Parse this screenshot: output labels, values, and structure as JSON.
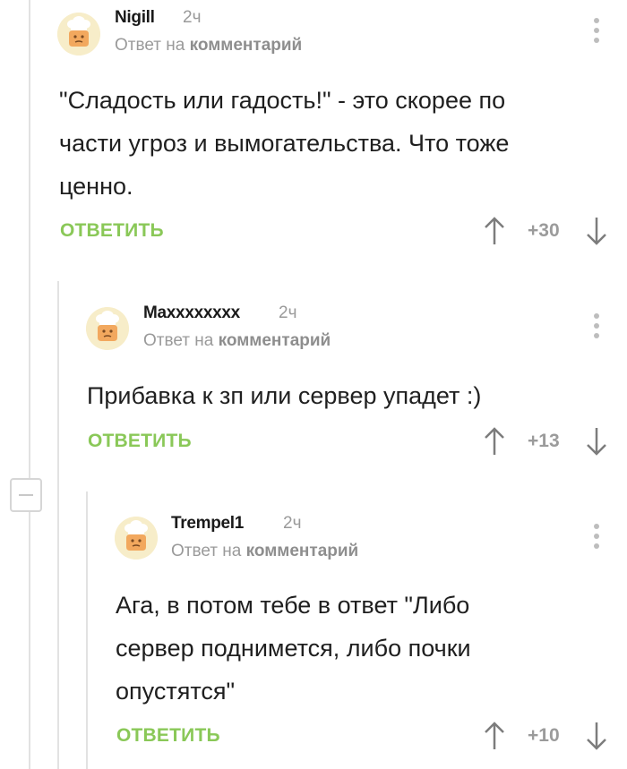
{
  "comments": [
    {
      "author": "Nigill",
      "time": "2ч",
      "reply_prefix": "Ответ на",
      "reply_target": "комментарий",
      "lines": [
        "\"Сладость или гадость!\" - это скорее по",
        "части угроз и вымогательства. Что тоже",
        "ценно."
      ],
      "reply_label": "ОТВЕТИТЬ",
      "rating": "+30"
    },
    {
      "author": "Maxxxxxxxx",
      "time": "2ч",
      "reply_prefix": "Ответ на",
      "reply_target": "комментарий",
      "lines": [
        "Прибавка к зп или сервер упадет :)"
      ],
      "reply_label": "ОТВЕТИТЬ",
      "rating": "+13"
    },
    {
      "author": "Trempel1",
      "time": "2ч",
      "reply_prefix": "Ответ на",
      "reply_target": "комментарий",
      "lines": [
        "Ага, в потом тебе в ответ \"Либо",
        "сервер поднимется, либо почки",
        "опустятся\""
      ],
      "reply_label": "ОТВЕТИТЬ",
      "rating": "+10"
    }
  ],
  "icons": {
    "avatar": "default-chef-avatar-icon",
    "menu": "more-vertical-icon",
    "upvote": "arrow-up-icon",
    "downvote": "arrow-down-icon",
    "collapse": "collapse-minus-icon"
  },
  "colors": {
    "reply_button": "#8ac858",
    "rating": "#9b9b9b",
    "muted": "#9a9a9a",
    "avatar_bg": "#f7edc9"
  }
}
